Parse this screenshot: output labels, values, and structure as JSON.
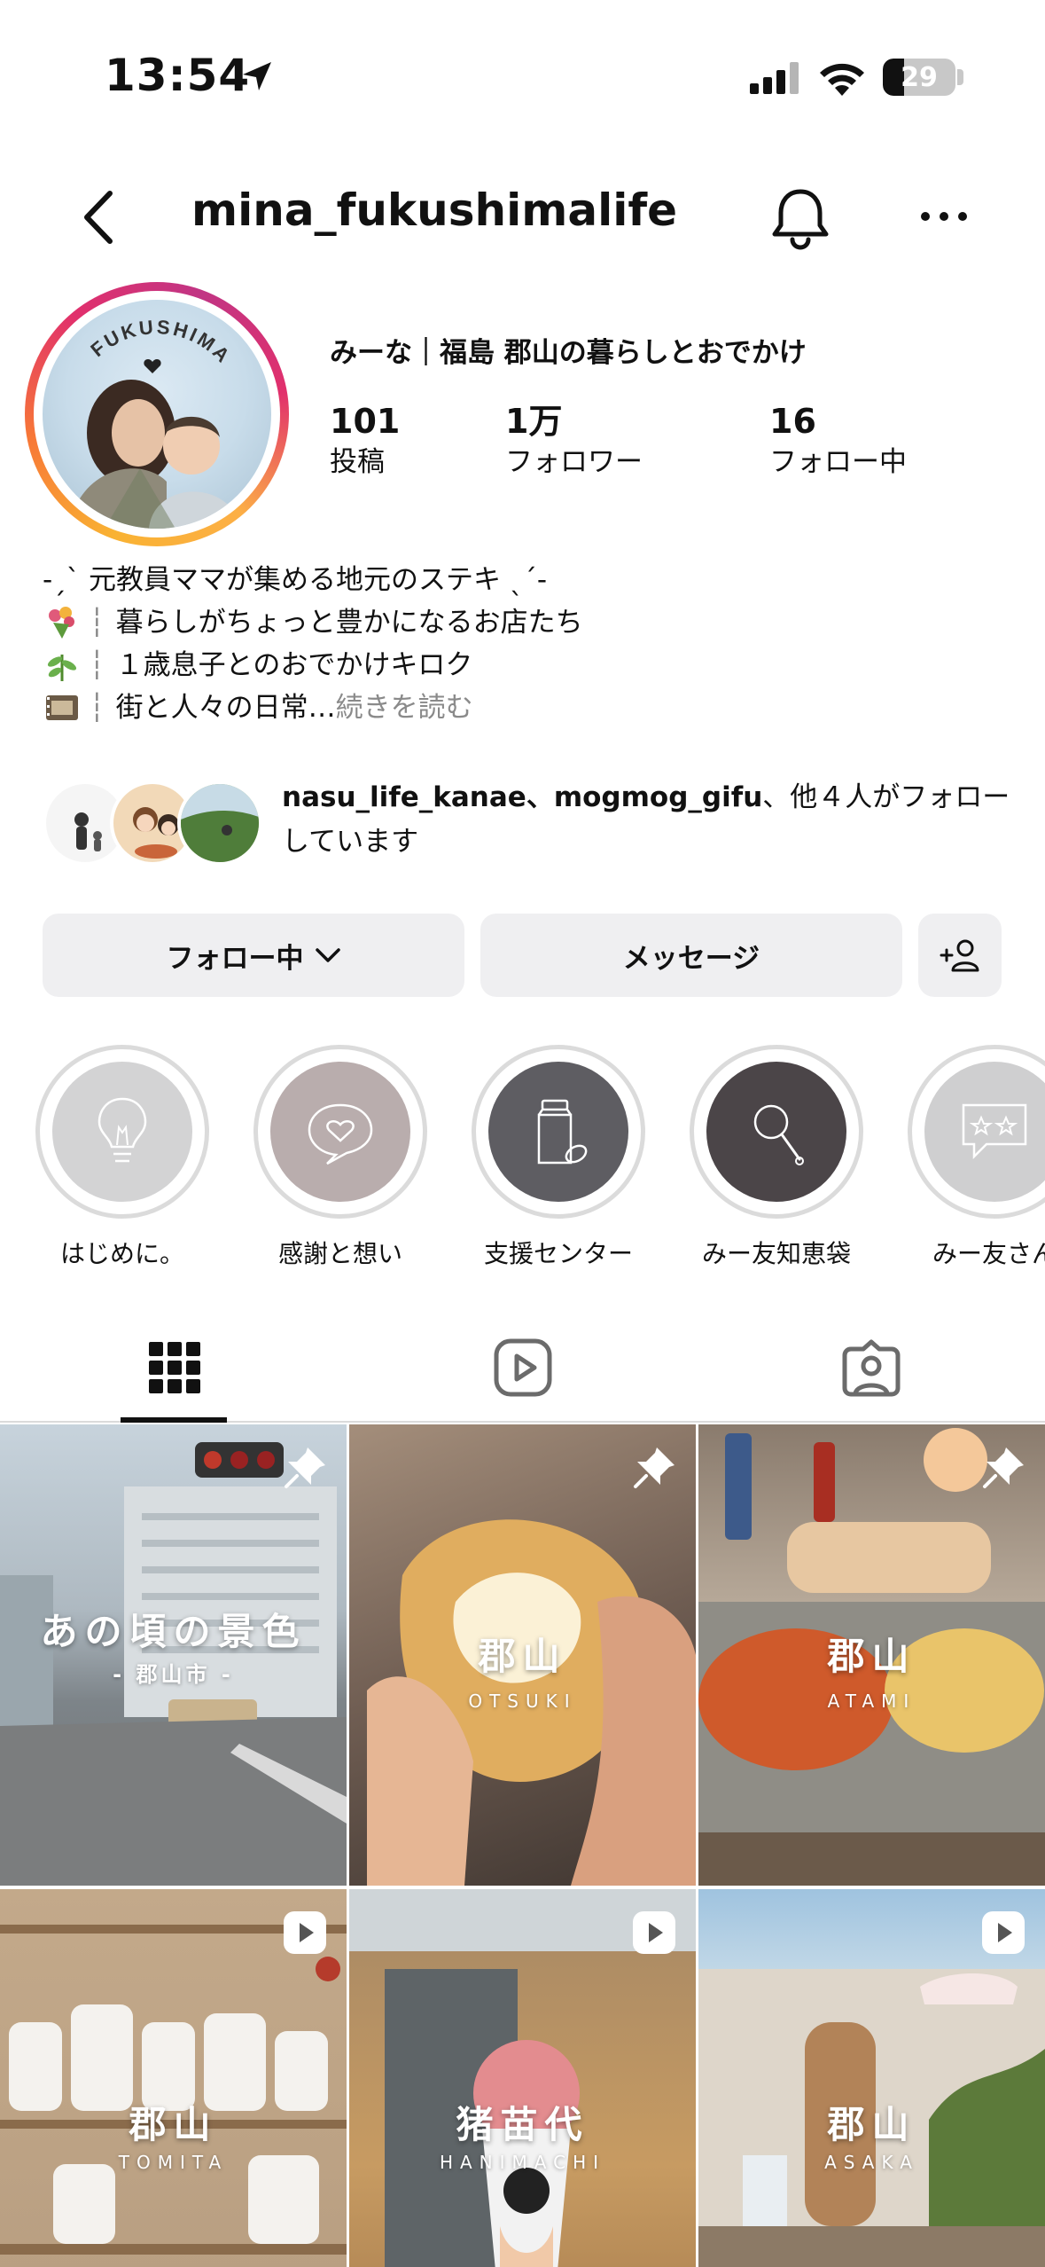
{
  "status": {
    "time": "13:54",
    "battery": "29"
  },
  "header": {
    "username": "mina_fukushimalife"
  },
  "profile": {
    "avatar_text": "FUKUSHIMA",
    "display_name": "みーな｜福島 郡山の暮らしとおでかけ",
    "stats": [
      {
        "value": "101",
        "label": "投稿"
      },
      {
        "value": "1万",
        "label": "フォロワー"
      },
      {
        "value": "16",
        "label": "フォロー中"
      }
    ],
    "bio": {
      "line1": "-ˏˋ 元教員ママが集める地元のステキ ˎˊ-",
      "line2": "暮らしがちょっと豊かになるお店たち",
      "line3": "１歳息子とのおでかけキロク",
      "line4": "街と人々の日常…",
      "more": " 続きを読む"
    },
    "followed_by": {
      "names": "nasu_life_kanae、mogmog_gifu",
      "rest": "、他４人がフォローしています"
    }
  },
  "actions": {
    "following": "フォロー中",
    "message": "メッセージ"
  },
  "highlights": [
    {
      "label": "はじめに。",
      "icon": "lightbulb-icon"
    },
    {
      "label": "感謝と想い",
      "icon": "heart-bubble-icon"
    },
    {
      "label": "支援センター",
      "icon": "baby-bottle-icon"
    },
    {
      "label": "みー友知恵袋",
      "icon": "magnifier-icon"
    },
    {
      "label": "みー友さん",
      "icon": "star-bubble-icon"
    }
  ],
  "tabs": [
    "grid-icon",
    "reels-icon",
    "tagged-icon"
  ],
  "posts": [
    {
      "title": "あの頃の景色",
      "subtitle": "- 郡山市 -",
      "badge": "pin"
    },
    {
      "title": "郡山",
      "subtitle": "OTSUKI",
      "badge": "pin"
    },
    {
      "title": "郡山",
      "subtitle": "ATAMI",
      "badge": "pin"
    },
    {
      "title": "郡山",
      "subtitle": "TOMITA",
      "badge": "reel"
    },
    {
      "title": "猪苗代",
      "subtitle": "HANIMACHI",
      "badge": "reel"
    },
    {
      "title": "郡山",
      "subtitle": "ASAKA",
      "badge": "reel"
    }
  ],
  "colors": {
    "button_bg": "#efeff1",
    "muted_text": "#8a8a8a"
  }
}
